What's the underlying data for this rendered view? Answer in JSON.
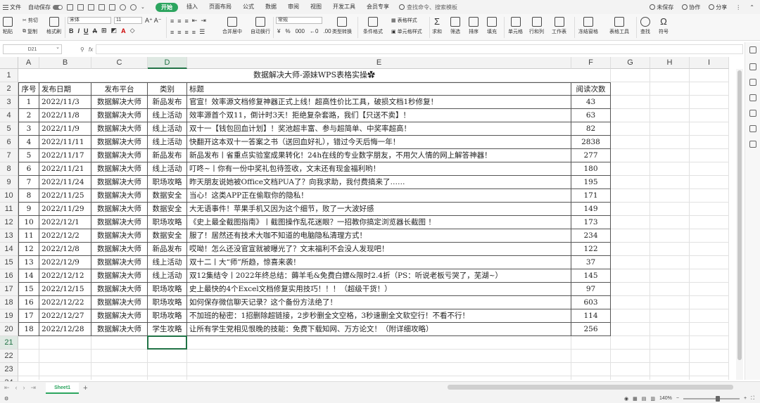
{
  "menubar": {
    "file": "文件",
    "autosave": "自动保存",
    "tabs": [
      "开始",
      "插入",
      "页面布局",
      "公式",
      "数据",
      "审阅",
      "视图",
      "开发工具",
      "会员专享"
    ],
    "active_tab": "开始",
    "search": "查找命令、搜索模板",
    "unsaved": "未保存",
    "collab": "协作",
    "share": "分享"
  },
  "ribbon": {
    "paste": "粘贴",
    "cut": "剪切",
    "copy": "复制",
    "format_painter": "格式刷",
    "font_name": "宋体",
    "font_size": "11",
    "bold": "B",
    "italic": "I",
    "underline": "U",
    "merge_center": "合并居中",
    "wrap_text": "自动换行",
    "number_format": "常规",
    "type_convert": "类型转换",
    "cond_format": "条件格式",
    "table_style": "表格样式",
    "cell_style": "单元格样式",
    "sum": "求和",
    "filter": "筛选",
    "sort": "排序",
    "fill": "填充",
    "cell": "单元格",
    "row_col": "行和列",
    "worksheet": "工作表",
    "freeze": "冻结窗格",
    "table_tools": "表格工具",
    "find": "查找",
    "symbol": "符号"
  },
  "formula_bar": {
    "name_box": "D21",
    "fx": "fx",
    "value": ""
  },
  "columns": [
    "A",
    "B",
    "C",
    "D",
    "E",
    "F",
    "G",
    "H",
    "I"
  ],
  "selected_column": "D",
  "row_numbers": [
    "1",
    "2",
    "3",
    "4",
    "5",
    "6",
    "7",
    "8",
    "9",
    "10",
    "11",
    "12",
    "13",
    "14",
    "15",
    "16",
    "17",
    "18",
    "19",
    "20",
    "21",
    "22",
    "23",
    "24"
  ],
  "sheet_title": "数据解决大师-源妹WPS表格实操✿",
  "headers": [
    "序号",
    "发布日期",
    "发布平台",
    "类别",
    "标题",
    "阅读次数"
  ],
  "rows": [
    [
      "1",
      "2022/11/3",
      "数据解决大师",
      "新品发布",
      "官宣！效率源文档修复神器正式上线！超高性价比工具，破损文档1秒修复！",
      "43"
    ],
    [
      "2",
      "2022/11/8",
      "数据解决大师",
      "线上活动",
      "效率源首个双11，倒计时3天！拒绝复杂套路，我们【只送不卖】！",
      "63"
    ],
    [
      "3",
      "2022/11/9",
      "数据解决大师",
      "线上活动",
      "双十一【钱包回血计划】！奖池超丰富、参与超简单、中奖率超高！",
      "82"
    ],
    [
      "4",
      "2022/11/11",
      "数据解决大师",
      "线上活动",
      "快翻开这本双十一答案之书（送回血好礼），错过今天后悔一年！",
      "2838"
    ],
    [
      "5",
      "2022/11/17",
      "数据解决大师",
      "新品发布",
      "新品发布丨省重点实验室成果转化！24h在线的专业数字朋友，不用欠人情的网上解答神器！",
      "277"
    ],
    [
      "6",
      "2022/11/21",
      "数据解决大师",
      "线上活动",
      "叮咚~丨你有一份中奖礼包待签收，文末还有现金福利哟！",
      "180"
    ],
    [
      "7",
      "2022/11/24",
      "数据解决大师",
      "职场攻略",
      "昨天朋友说她被Office文档PUA了？向我求助，我付费搞来了……",
      "195"
    ],
    [
      "8",
      "2022/11/25",
      "数据解决大师",
      "数据安全",
      "当心！这类APP正在偷取你的隐私！",
      "171"
    ],
    [
      "9",
      "2022/11/29",
      "数据解决大师",
      "数据安全",
      "大无语事件！苹果手机又因为这个细节，败了一大波好感",
      "149"
    ],
    [
      "10",
      "2022/12/1",
      "数据解决大师",
      "职场攻略",
      "《史上最全截图指南》丨截图操作乱花迷眼？一招教你搞定浏览器长截图 ！",
      "173"
    ],
    [
      "11",
      "2022/12/2",
      "数据解决大师",
      "数据安全",
      "服了！居然还有技术大咖不知道的电脑隐私清理方式！",
      "234"
    ],
    [
      "12",
      "2022/12/8",
      "数据解决大师",
      "新品发布",
      "哎呦！怎么还没官宣就被曝光了？文末福利不会没人发现吧！",
      "122"
    ],
    [
      "13",
      "2022/12/9",
      "数据解决大师",
      "线上活动",
      "双十二丨大“师”所趋，惊喜来袭！",
      "37"
    ],
    [
      "14",
      "2022/12/12",
      "数据解决大师",
      "线上活动",
      "双12集结令丨2022年终总结：薅羊毛&免费白嫖&限时2.4折（PS：听说老板亏哭了，芜湖~）",
      "145"
    ],
    [
      "15",
      "2022/12/15",
      "数据解决大师",
      "职场攻略",
      "史上最快的4个Excel文档修复实用技巧！！！（超级干货！）",
      "97"
    ],
    [
      "16",
      "2022/12/22",
      "数据解决大师",
      "职场攻略",
      "如何保存微信聊天记录？这个备份方法绝了！",
      "603"
    ],
    [
      "17",
      "2022/12/27",
      "数据解决大师",
      "职场攻略",
      "不加班的秘密：1招删除超链接，2步秒删全文空格，3秒速删全文软空行！不看不行！",
      "114"
    ],
    [
      "18",
      "2022/12/28",
      "数据解决大师",
      "学生攻略",
      "让所有学生党相见恨晚的技能：免费下载知网、万方论文！（附详细攻略）",
      "256"
    ]
  ],
  "sheet_tab": "Sheet1",
  "status": {
    "zoom": "140%"
  }
}
